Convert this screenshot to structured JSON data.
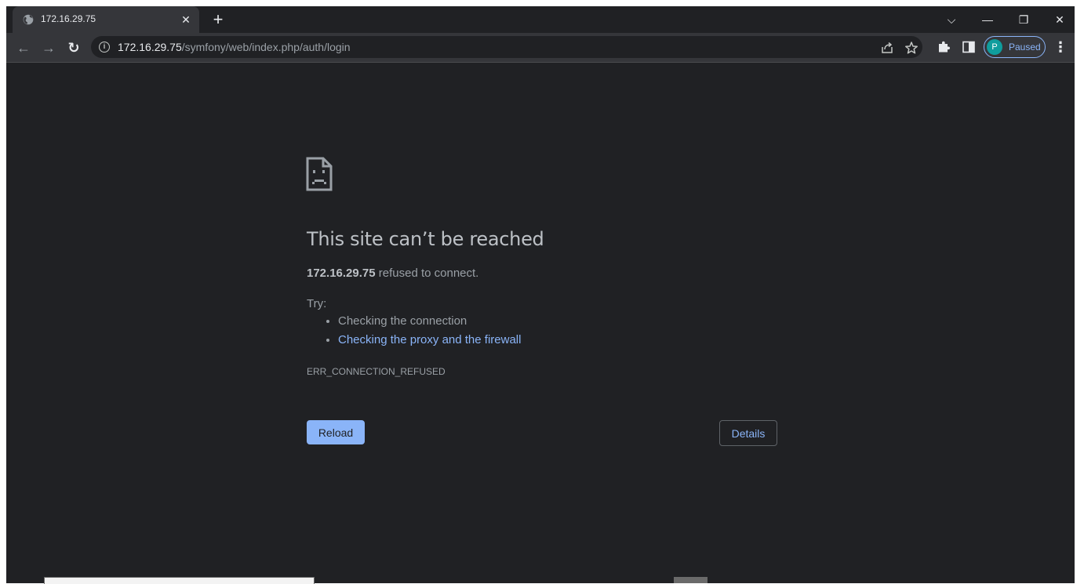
{
  "tab": {
    "title": "172.16.29.75",
    "close": "✕",
    "new_tab": "+"
  },
  "window_controls": {
    "dropdown": "⌵",
    "minimize": "—",
    "restore": "❐",
    "close": "✕"
  },
  "toolbar": {
    "back": "←",
    "forward": "→",
    "reload": "↻",
    "url_host": "172.16.29.75",
    "url_path": "/symfony/web/index.php/auth/login",
    "info": "i"
  },
  "profile": {
    "initial": "P",
    "label": "Paused"
  },
  "error": {
    "heading": "This site can’t be reached",
    "host": "172.16.29.75",
    "summary_rest": " refused to connect.",
    "try_label": "Try:",
    "suggestions": [
      "Checking the connection",
      "Checking the proxy and the firewall"
    ],
    "code": "ERR_CONNECTION_REFUSED"
  },
  "buttons": {
    "reload": "Reload",
    "details": "Details"
  },
  "colors": {
    "background": "#202124",
    "accent": "#8ab4f8",
    "toolbar": "#35363a"
  }
}
